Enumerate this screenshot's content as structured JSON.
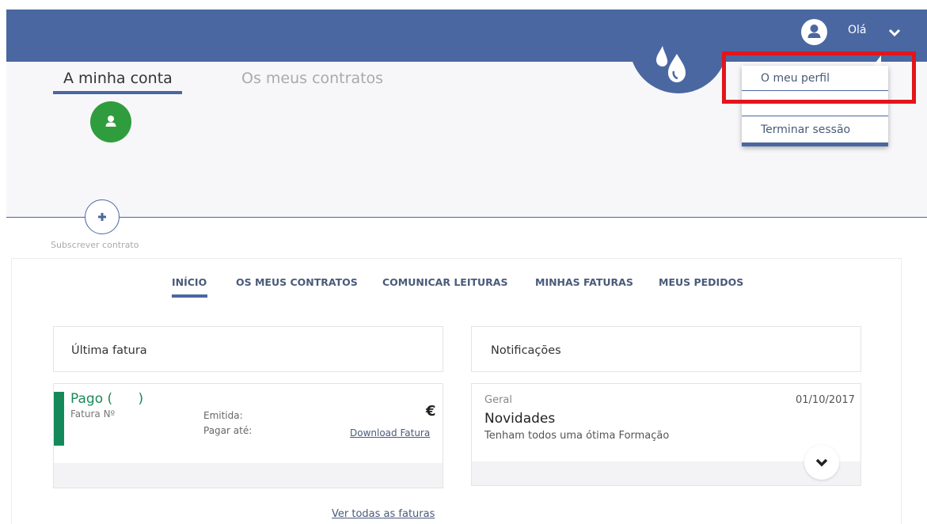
{
  "header": {
    "greeting": "Olá",
    "brand_color": "#4a67a1"
  },
  "user_menu": {
    "items": [
      {
        "label": "O meu perfil"
      },
      {
        "label": ""
      },
      {
        "label": "Terminar sessão"
      }
    ]
  },
  "account": {
    "tabs": [
      {
        "label": "A minha conta",
        "active": true
      },
      {
        "label": "Os meus contratos",
        "active": false
      }
    ],
    "subscribe_label": "Subscrever contrato"
  },
  "nav": {
    "tabs": [
      {
        "label": "INÍCIO",
        "active": true
      },
      {
        "label": "OS MEUS CONTRATOS"
      },
      {
        "label": "COMUNICAR LEITURAS"
      },
      {
        "label": "MINHAS FATURAS"
      },
      {
        "label": "MEUS PEDIDOS"
      }
    ]
  },
  "last_invoice": {
    "title": "Última fatura",
    "status": "Pago (      )",
    "invoice_no_label": "Fatura Nº",
    "emitted_label": "Emitida:",
    "due_label": "Pagar até:",
    "amount": "€",
    "download_label": "Download Fatura",
    "see_all_label": "Ver todas as faturas",
    "status_color": "#148a5a"
  },
  "notifications": {
    "title": "Notificações",
    "items": [
      {
        "category": "Geral",
        "date": "01/10/2017",
        "title": "Novidades",
        "message": "Tenham todos uma ótima Formação"
      }
    ]
  },
  "icons": {
    "user": "user-icon",
    "chevron": "chevron-down-icon",
    "plus": "plus-icon",
    "logo": "water-drops-logo"
  },
  "highlight_color": "#e3151b"
}
